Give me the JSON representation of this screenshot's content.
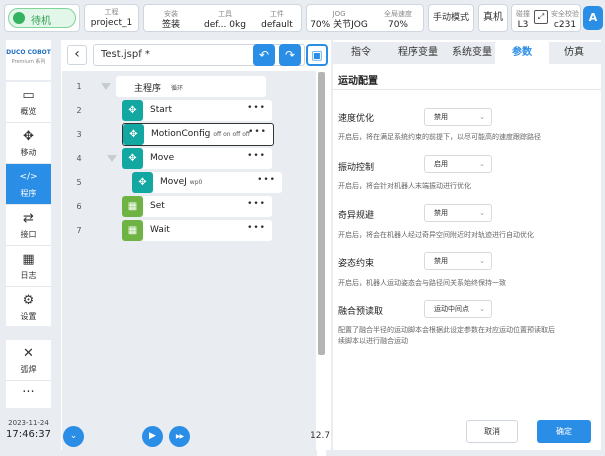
{
  "status": {
    "standby": "待机",
    "project_label": "工程",
    "project_value": "project_1",
    "install_label": "安装",
    "install_value": "签装",
    "tool_label": "工具",
    "tool_value": "def...",
    "payload_value": "0kg",
    "workpiece_label": "工件",
    "workpiece_value": "default",
    "jog_label": "JOG",
    "jog_speed": "70%",
    "jog_value": "关节JOG",
    "global_speed_label": "全局速度",
    "global_speed_value": "70%",
    "mode": "手动模式",
    "machine": "真机",
    "collision_label": "碰撞",
    "collision_value": "L3",
    "safety_label": "安全校验",
    "safety_value": "c231",
    "avatar": "A"
  },
  "brand": {
    "name": "DUCO COBOT",
    "sub": "Premium 系列"
  },
  "nav": [
    {
      "label": "概览",
      "icon": "▭"
    },
    {
      "label": "移动",
      "icon": "✥"
    },
    {
      "label": "程序",
      "icon": "</>"
    },
    {
      "label": "接口",
      "icon": "⇄"
    },
    {
      "label": "日志",
      "icon": "▦"
    },
    {
      "label": "设置",
      "icon": "⚙"
    }
  ],
  "weld": {
    "label": "弧焊",
    "icon": "✕"
  },
  "more": "···",
  "clock": {
    "date": "2023-11-24",
    "time": "17:46:37"
  },
  "editor": {
    "file": "Test.jspf *",
    "undo_icon": "↶",
    "redo_icon": "↷",
    "save_icon": "▣",
    "back_icon": "‹",
    "dropdown_icon": "⌄",
    "main_program": "主程序",
    "main_loop": "循环",
    "rows": [
      {
        "num": "1"
      },
      {
        "num": "2",
        "name": "Start",
        "sub": "",
        "more": "•••"
      },
      {
        "num": "3",
        "name": "MotionConfig",
        "sub": "off on off off",
        "more": "•••"
      },
      {
        "num": "4",
        "name": "Move",
        "sub": "",
        "more": "•••"
      },
      {
        "num": "5",
        "name": "MoveJ",
        "sub": "wp0",
        "more": "•••"
      },
      {
        "num": "6",
        "name": "Set",
        "sub": "",
        "more": "•••"
      },
      {
        "num": "7",
        "name": "Wait",
        "sub": "",
        "more": "•••"
      }
    ],
    "version": "12.7",
    "collapse_icon": "⌄",
    "play_icon": "▶",
    "ff_icon": "▶▶"
  },
  "tabs": [
    "指令",
    "程序变量",
    "系统变量",
    "参数",
    "仿真"
  ],
  "panel": {
    "title": "运动配置",
    "items": [
      {
        "label": "速度优化",
        "value": "禁用",
        "desc": "开启后，将在满足系统约束的前提下，以尽可能高的速度跟踪路径"
      },
      {
        "label": "振动控制",
        "value": "启用",
        "desc": "开启后，将会针对机器人末端振动进行优化"
      },
      {
        "label": "奇异规避",
        "value": "禁用",
        "desc": "开启后，将会在机器人经过奇异空间附近时对轨迹进行自动优化"
      },
      {
        "label": "姿态约束",
        "value": "禁用",
        "desc": "开启后，机器人运动姿态会与路径间关系始终保持一致"
      },
      {
        "label": "融合预读取",
        "value": "运动中间点",
        "desc": "配置了融合半径的运动脚本会根据此设定参数在对应运动位置预读取后",
        "desc2": "续脚本以进行融合运动"
      }
    ],
    "chevron": "⌄",
    "cancel": "取消",
    "confirm": "确定"
  }
}
